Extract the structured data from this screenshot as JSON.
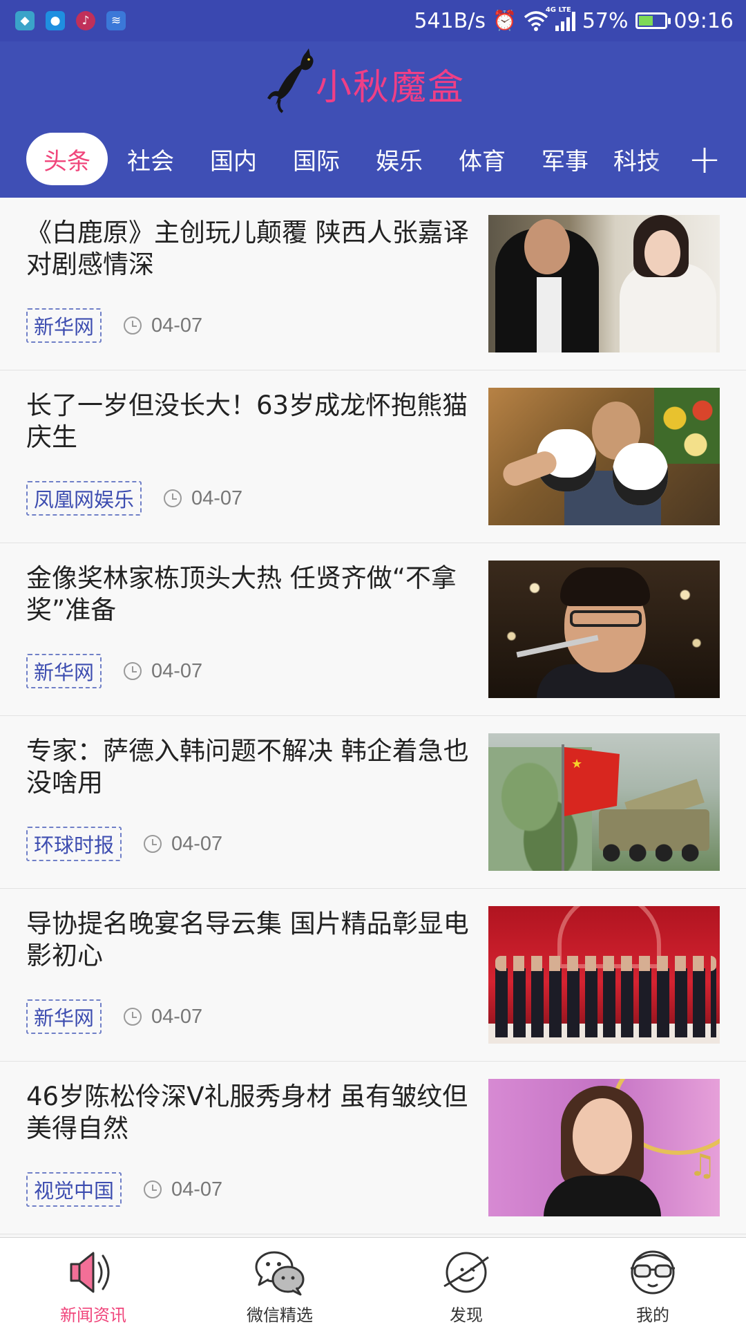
{
  "status_bar": {
    "speed": "541B/s",
    "network": "4G LTE",
    "battery": "57%",
    "battery_level": 0.57,
    "time": "09:16"
  },
  "header": {
    "logo_text": "小秋魔盒"
  },
  "tabs": [
    {
      "label": "头条",
      "active": true
    },
    {
      "label": "社会",
      "active": false
    },
    {
      "label": "国内",
      "active": false
    },
    {
      "label": "国际",
      "active": false
    },
    {
      "label": "娱乐",
      "active": false
    },
    {
      "label": "体育",
      "active": false
    },
    {
      "label": "军事",
      "active": false
    },
    {
      "label": "科技",
      "active": false
    }
  ],
  "add_tab_symbol": "+",
  "news": [
    {
      "title": "《白鹿原》主创玩儿颠覆 陕西人张嘉译对剧感情深",
      "source": "新华网",
      "date": "04-07"
    },
    {
      "title": "长了一岁但没长大！63岁成龙怀抱熊猫庆生",
      "source": "凤凰网娱乐",
      "date": "04-07"
    },
    {
      "title": "金像奖林家栋顶头大热 任贤齐做“不拿奖”准备",
      "source": "新华网",
      "date": "04-07"
    },
    {
      "title": "专家：萨德入韩问题不解决 韩企着急也没啥用",
      "source": "环球时报",
      "date": "04-07"
    },
    {
      "title": "导协提名晚宴名导云集 国片精品彰显电影初心",
      "source": "新华网",
      "date": "04-07"
    },
    {
      "title": "46岁陈松伶深V礼服秀身材 虽有皱纹但美得自然",
      "source": "视觉中国",
      "date": "04-07"
    }
  ],
  "bottom_nav": [
    {
      "label": "新闻资讯",
      "icon": "speaker-icon",
      "active": true
    },
    {
      "label": "微信精选",
      "icon": "chat-bubbles-icon",
      "active": false
    },
    {
      "label": "发现",
      "icon": "planet-icon",
      "active": false
    },
    {
      "label": "我的",
      "icon": "glasses-face-icon",
      "active": false
    }
  ],
  "colors": {
    "header_bg": "#3f4fb5",
    "accent_pink": "#f0457b",
    "source_tag": "#3d4db0"
  }
}
